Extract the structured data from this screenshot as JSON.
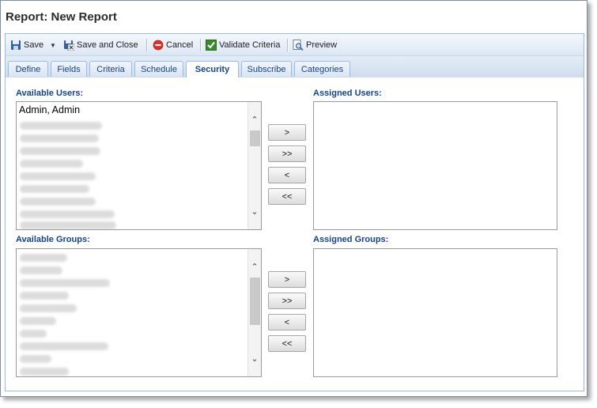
{
  "window": {
    "title": "Report: New Report"
  },
  "toolbar": {
    "save": "Save",
    "save_and_close": "Save and Close",
    "cancel": "Cancel",
    "validate_criteria": "Validate Criteria",
    "preview": "Preview"
  },
  "tabs": [
    {
      "label": "Define"
    },
    {
      "label": "Fields"
    },
    {
      "label": "Criteria"
    },
    {
      "label": "Schedule"
    },
    {
      "label": "Security",
      "active": true
    },
    {
      "label": "Subscribe"
    },
    {
      "label": "Categories"
    }
  ],
  "users": {
    "available_label": "Available Users:",
    "assigned_label": "Assigned Users:",
    "available_items": [
      "Admin, Admin"
    ]
  },
  "groups": {
    "available_label": "Available Groups:",
    "assigned_label": "Assigned Groups:"
  },
  "move_buttons": {
    "add": ">",
    "add_all": ">>",
    "remove": "<",
    "remove_all": "<<"
  },
  "icons": {
    "save": "floppy-disk-icon",
    "dropdown": "caret-down-icon",
    "save_and_close": "save-close-icon",
    "cancel": "no-entry-icon",
    "validate": "checkmark-icon",
    "preview": "magnifier-document-icon"
  },
  "colors": {
    "label_blue": "#15428b",
    "toolbar_border": "#99bbe8",
    "cancel_red": "#d9332b",
    "validate_green": "#3a8a2b"
  }
}
